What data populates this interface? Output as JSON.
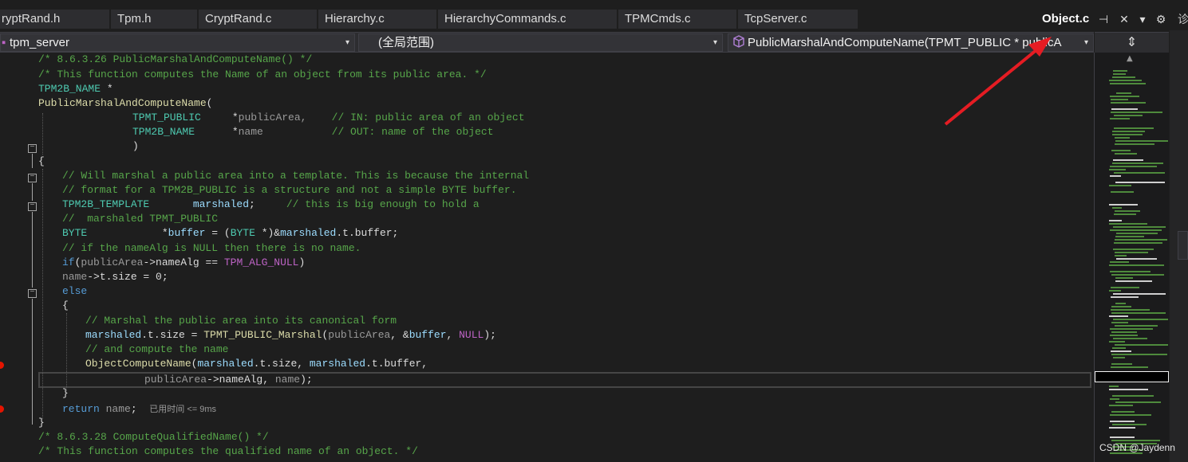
{
  "tabs": [
    {
      "label": "ryptRand.h"
    },
    {
      "label": "Tpm.h"
    },
    {
      "label": "CryptRand.c"
    },
    {
      "label": "Hierarchy.c"
    },
    {
      "label": "HierarchyCommands.c"
    },
    {
      "label": "TPMCmds.c"
    },
    {
      "label": "TcpServer.c"
    }
  ],
  "active_tab": {
    "label": "Object.c",
    "pin_glyph": "⊣",
    "close_glyph": "✕"
  },
  "tab_controls": {
    "dropdown_glyph": "▾",
    "settings_glyph": "⚙",
    "right_panel_glyph": "诊"
  },
  "nav": {
    "project": "tpm_server",
    "scope": "(全局范围)",
    "member": "PublicMarshalAndComputeName(TPMT_PUBLIC * publicA",
    "dropdown_glyph": "▾",
    "split_glyph": "⇕"
  },
  "code": {
    "l1": "/* 8.6.3.26 PublicMarshalAndComputeName() */",
    "l2": "/* This function computes the Name of an object from its public area. */",
    "l3_type": "TPM2B_NAME",
    "l3_rest": " *",
    "l4_fn": "PublicMarshalAndComputeName",
    "l4_rest": "(",
    "l5_type": "TPMT_PUBLIC",
    "l5_mid": "     *",
    "l5_param": "publicArea,",
    "l5_cm": "    // IN: public area of an object",
    "l6_type": "TPM2B_NAME",
    "l6_mid": "      *",
    "l6_param": "name",
    "l6_cm": "           // OUT: name of the object",
    "l7": ")",
    "l8": "{",
    "l9": "// Will marshal a public area into a template. This is because the internal",
    "l10": "// format for a TPM2B_PUBLIC is a structure and not a simple BYTE buffer.",
    "l11_type": "TPM2B_TEMPLATE",
    "l11_var": "marshaled",
    "l11_rest": ";",
    "l11_cm": "     // this is big enough to hold a",
    "l12": "//  marshaled TPMT_PUBLIC",
    "l13_type": "BYTE",
    "l13_a": "*",
    "l13_var": "buffer",
    "l13_b": " = (",
    "l13_type2": "BYTE",
    "l13_c": " *)&",
    "l13_var2": "marshaled",
    "l13_d": ".t.buffer;",
    "l14": "// if the nameAlg is NULL then there is no name.",
    "l15_kw": "if",
    "l15_a": "(",
    "l15_param": "publicArea",
    "l15_b": "->nameAlg == ",
    "l15_mc": "TPM_ALG_NULL",
    "l15_c": ")",
    "l16_param": "name",
    "l16_rest": "->t.size = 0;",
    "l17_kw": "else",
    "l18": "{",
    "l19": "// Marshal the public area into its canonical form",
    "l20_var": "marshaled",
    "l20_a": ".t.size = ",
    "l20_fn": "TPMT_PUBLIC_Marshal",
    "l20_b": "(",
    "l20_param": "publicArea",
    "l20_c": ", &",
    "l20_var2": "buffer",
    "l20_d": ", ",
    "l20_mc": "NULL",
    "l20_e": ");",
    "l21": "// and compute the name",
    "l22_fn": "ObjectComputeName",
    "l22_a": "(",
    "l22_var": "marshaled",
    "l22_b": ".t.size, ",
    "l22_var2": "marshaled",
    "l22_c": ".t.buffer,",
    "l23_param": "publicArea",
    "l23_a": "->nameAlg, ",
    "l23_param2": "name",
    "l23_b": ");",
    "l24": "}",
    "l25_kw": "return",
    "l25_param": "name",
    "l25_rest": ";",
    "l25_hint": "已用时间 <= 9ms",
    "l26": "}",
    "l27": "/* 8.6.3.28 ComputeQualifiedName() */",
    "l28": "/* This function computes the qualified name of an object. */"
  },
  "fold_glyph": "−",
  "minimap": {
    "scroll_up_glyph": "▲"
  },
  "watermark": "CSDN @Jaydenn",
  "colors": {
    "background": "#1e1e1e",
    "comment": "#57a64a",
    "keyword": "#569cd6",
    "type": "#4ec9b0",
    "function": "#dcdcaa",
    "variable": "#9cdcfe",
    "parameter": "#9a9a9a",
    "macro": "#bd63c5",
    "annotation_arrow": "#e51c23"
  }
}
